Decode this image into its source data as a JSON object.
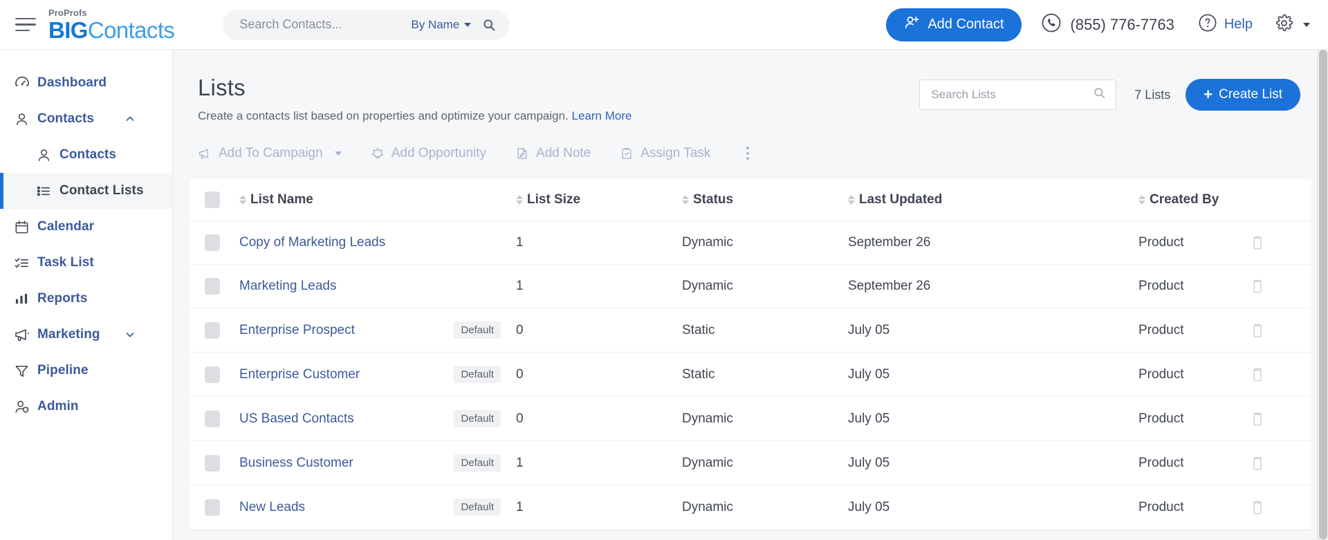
{
  "header": {
    "menu_icon": "hamburger-icon",
    "logo": {
      "pro": "ProProfs",
      "big": "BIG",
      "contacts": "Contacts"
    },
    "search": {
      "placeholder": "Search Contacts...",
      "value": "",
      "filter_label": "By Name",
      "search_icon": "search-icon"
    },
    "add_contact_label": "Add Contact",
    "phone": "(855) 776-7763",
    "help_label": "Help",
    "gear_icon": "gear-icon"
  },
  "sidebar": {
    "items": [
      {
        "label": "Dashboard",
        "icon": "speedometer-icon",
        "active": false,
        "sub": false,
        "chevron": ""
      },
      {
        "label": "Contacts",
        "icon": "user-icon",
        "active": false,
        "sub": false,
        "chevron": "up"
      },
      {
        "label": "Contacts",
        "icon": "user-icon",
        "active": false,
        "sub": true,
        "chevron": ""
      },
      {
        "label": "Contact Lists",
        "icon": "list-icon",
        "active": true,
        "sub": true,
        "chevron": ""
      },
      {
        "label": "Calendar",
        "icon": "calendar-icon",
        "active": false,
        "sub": false,
        "chevron": ""
      },
      {
        "label": "Task List",
        "icon": "checklist-icon",
        "active": false,
        "sub": false,
        "chevron": ""
      },
      {
        "label": "Reports",
        "icon": "bar-chart-icon",
        "active": false,
        "sub": false,
        "chevron": ""
      },
      {
        "label": "Marketing",
        "icon": "megaphone-icon",
        "active": false,
        "sub": false,
        "chevron": "down"
      },
      {
        "label": "Pipeline",
        "icon": "funnel-icon",
        "active": false,
        "sub": false,
        "chevron": ""
      },
      {
        "label": "Admin",
        "icon": "user-shield-icon",
        "active": false,
        "sub": false,
        "chevron": ""
      }
    ]
  },
  "page": {
    "title": "Lists",
    "subtitle": "Create a contacts list based on properties and optimize your campaign.",
    "learn_more": "Learn More",
    "search_placeholder": "Search Lists",
    "search_value": "",
    "count_label": "7 Lists",
    "create_label": "Create List",
    "create_plus": "+"
  },
  "actions": [
    {
      "label": "Add To Campaign",
      "icon": "megaphone-icon",
      "caret": true
    },
    {
      "label": "Add Opportunity",
      "icon": "star-badge-icon",
      "caret": false
    },
    {
      "label": "Add Note",
      "icon": "note-icon",
      "caret": false
    },
    {
      "label": "Assign Task",
      "icon": "clipboard-check-icon",
      "caret": false
    }
  ],
  "table": {
    "columns": [
      {
        "key": "checkbox",
        "label": "",
        "sortable": false
      },
      {
        "key": "name",
        "label": "List Name",
        "sortable": true
      },
      {
        "key": "size",
        "label": "List Size",
        "sortable": true
      },
      {
        "key": "status",
        "label": "Status",
        "sortable": true
      },
      {
        "key": "updated",
        "label": "Last Updated",
        "sortable": true
      },
      {
        "key": "created",
        "label": "Created By",
        "sortable": true
      },
      {
        "key": "actions",
        "label": "",
        "sortable": false
      }
    ],
    "rows": [
      {
        "name": "Copy of Marketing Leads",
        "badge": "",
        "size": "1",
        "status": "Dynamic",
        "updated": "September 26",
        "created": "Product",
        "delete_icon": "trash-icon"
      },
      {
        "name": "Marketing Leads",
        "badge": "",
        "size": "1",
        "status": "Dynamic",
        "updated": "September 26",
        "created": "Product",
        "delete_icon": "trash-icon"
      },
      {
        "name": "Enterprise Prospect",
        "badge": "Default",
        "size": "0",
        "status": "Static",
        "updated": "July 05",
        "created": "Product",
        "delete_icon": "trash-icon"
      },
      {
        "name": "Enterprise Customer",
        "badge": "Default",
        "size": "0",
        "status": "Static",
        "updated": "July 05",
        "created": "Product",
        "delete_icon": "trash-icon"
      },
      {
        "name": "US Based Contacts",
        "badge": "Default",
        "size": "0",
        "status": "Dynamic",
        "updated": "July 05",
        "created": "Product",
        "delete_icon": "trash-icon"
      },
      {
        "name": "Business Customer",
        "badge": "Default",
        "size": "1",
        "status": "Dynamic",
        "updated": "July 05",
        "created": "Product",
        "delete_icon": "trash-icon"
      },
      {
        "name": "New Leads",
        "badge": "Default",
        "size": "1",
        "status": "Dynamic",
        "updated": "July 05",
        "created": "Product",
        "delete_icon": "trash-icon"
      }
    ]
  },
  "colors": {
    "accent": "#1b72d9",
    "link": "#3d5a99",
    "muted_action": "#a9b3cd",
    "page_bg": "#f6f7f8"
  }
}
